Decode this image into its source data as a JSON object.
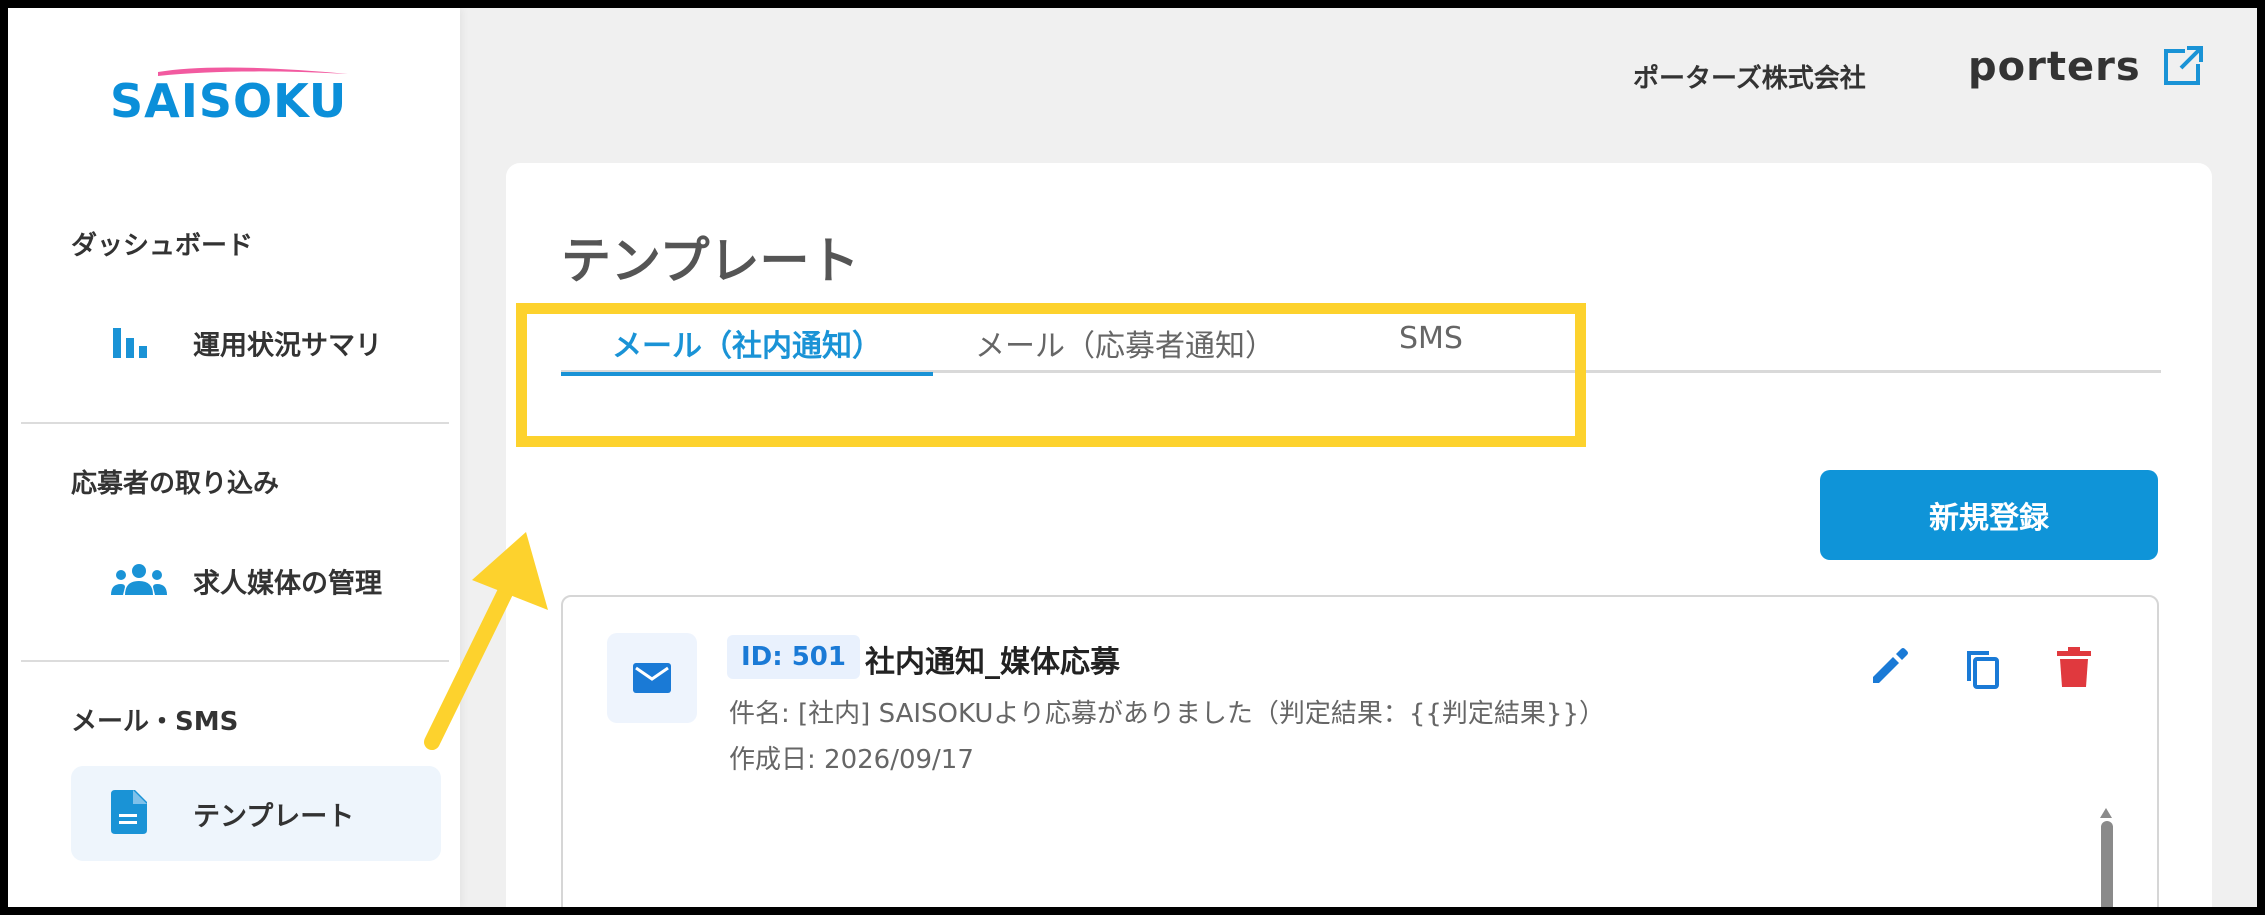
{
  "sidebar": {
    "logo_text": "SAISOKU",
    "sections": [
      {
        "title": "ダッシュボード",
        "item": {
          "label": "運用状況サマリ",
          "icon": "bar-chart-icon"
        }
      },
      {
        "title": "応募者の取り込み",
        "item": {
          "label": "求人媒体の管理",
          "icon": "group-icon"
        }
      },
      {
        "title": "メール・SMS",
        "item": {
          "label": "テンプレート",
          "icon": "document-icon",
          "active": true
        }
      }
    ]
  },
  "header": {
    "company": "ポーターズ株式会社",
    "brand": "porters",
    "external_icon": "external-link-icon"
  },
  "main": {
    "title": "テンプレート",
    "tabs": [
      {
        "label": "メール（社内通知）",
        "active": true
      },
      {
        "label": "メール（応募者通知）",
        "active": false
      },
      {
        "label": "SMS",
        "active": false
      }
    ],
    "new_button": "新規登録",
    "template": {
      "id": "ID: 501",
      "name": "社内通知_媒体応募",
      "subject": "件名: [社内] SAISOKUより応募がありました（判定結果：{{判定結果}}）",
      "created": "作成日: 2026/09/17",
      "icon": "mail-icon",
      "actions": [
        "edit-icon",
        "copy-icon",
        "delete-icon"
      ]
    }
  },
  "colors": {
    "accent": "#1a93d6",
    "highlight": "#fdd22d",
    "delete": "#e0393e",
    "logo_pink": "#f25aa0"
  }
}
